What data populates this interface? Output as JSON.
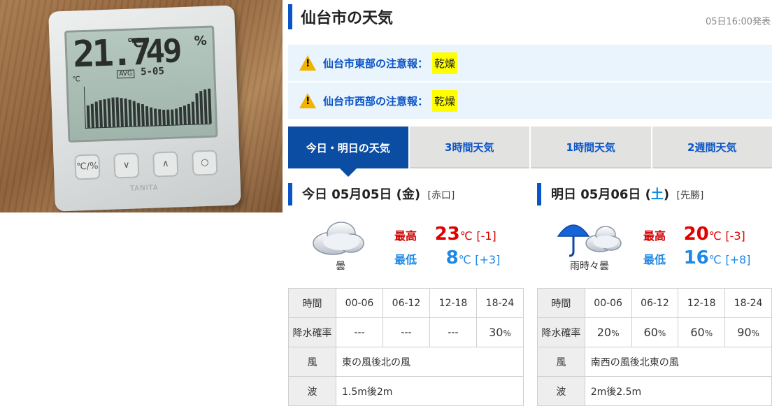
{
  "page": {
    "title": "仙台市の天気",
    "issued": "05日16:00発表"
  },
  "warnings": [
    {
      "label": "仙台市東部の注意報：",
      "badge": "乾燥"
    },
    {
      "label": "仙台市西部の注意報：",
      "badge": "乾燥"
    }
  ],
  "tabs": [
    {
      "label": "今日・明日の天気",
      "active": true
    },
    {
      "label": "3時間天気"
    },
    {
      "label": "1時間天気"
    },
    {
      "label": "2週間天気"
    }
  ],
  "today": {
    "prefix": "今日",
    "date": "05月05日",
    "weekday_open": "(",
    "weekday": "金",
    "weekday_close": ")",
    "rokuyo": "[赤口]",
    "weather": "曇",
    "icon": "cloud-icon",
    "high_label": "最高",
    "high": "23",
    "high_diff": "[-1]",
    "low_label": "最低",
    "low": "8",
    "low_diff": "[+3]",
    "deg": "℃",
    "table": {
      "time_label": "時間",
      "times": [
        "00-06",
        "06-12",
        "12-18",
        "18-24"
      ],
      "rain_label": "降水確率",
      "rain": [
        "---",
        "---",
        "---",
        "30"
      ],
      "wind_label": "風",
      "wind": "東の風後北の風",
      "wave_label": "波",
      "wave": "1.5m後2m"
    }
  },
  "tomorrow": {
    "prefix": "明日",
    "date": "05月06日",
    "weekday_open": "(",
    "weekday": "土",
    "weekday_close": ")",
    "rokuyo": "[先勝]",
    "weather": "雨時々曇",
    "icon": "umbrella-cloud-icon",
    "high_label": "最高",
    "high": "20",
    "high_diff": "[-3]",
    "low_label": "最低",
    "low": "16",
    "low_diff": "[+8]",
    "deg": "℃",
    "table": {
      "time_label": "時間",
      "times": [
        "00-06",
        "06-12",
        "12-18",
        "18-24"
      ],
      "rain_label": "降水確率",
      "rain": [
        "20",
        "60",
        "60",
        "90"
      ],
      "wind_label": "風",
      "wind": "南西の風後北東の風",
      "wave_label": "波",
      "wave": "2m後2.5m"
    }
  },
  "percent_sign": "%",
  "photo": {
    "lcd_temp": "21.7",
    "lcd_temp_unit": "℃",
    "lcd_humidity": "49",
    "lcd_humidity_unit": "%",
    "lcd_small_unit": "℃",
    "lcd_avg": "AVG",
    "lcd_date": "5-05",
    "button_1": "℃/%",
    "button_2": "∨",
    "button_3": "∧",
    "button_4": "○",
    "brand": "TANITA"
  },
  "colors": {
    "accent": "#0b54c6",
    "active_tab": "#0b4da2",
    "high": "#e00000",
    "low": "#1e88e5",
    "warning_bg": "#eaf4fc",
    "badge": "#ffff00"
  }
}
